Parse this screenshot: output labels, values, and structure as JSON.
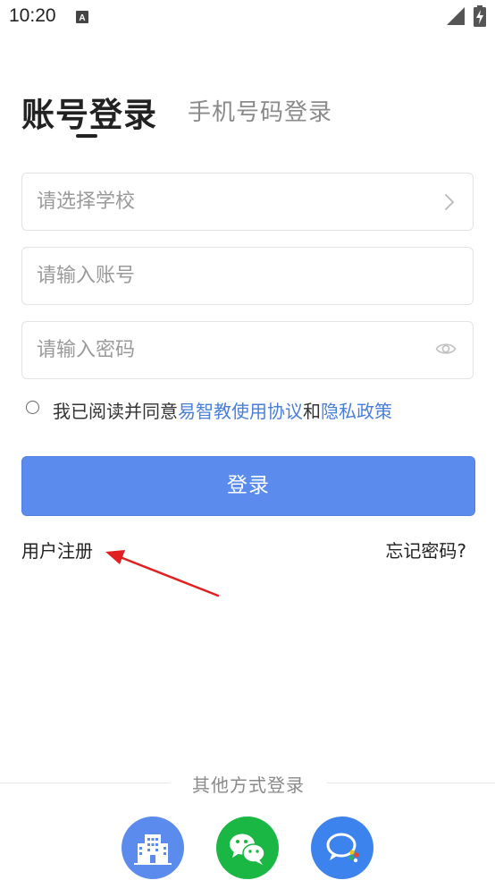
{
  "status_bar": {
    "time": "10:20",
    "notification_icon": "a-box-icon",
    "signal_icon": "signal-icon",
    "battery_icon": "battery-charging-icon"
  },
  "tabs": {
    "account_login": "账号登录",
    "phone_login": "手机号码登录"
  },
  "form": {
    "school_placeholder": "请选择学校",
    "account_placeholder": "请输入账号",
    "password_placeholder": "请输入密码"
  },
  "agreement": {
    "prefix": "我已阅读并同意",
    "terms_link": "易智教使用协议",
    "conjunction": "和",
    "privacy_link": "隐私政策"
  },
  "buttons": {
    "login": "登录",
    "register": "用户注册",
    "forgot": "忘记密码?"
  },
  "other_login": {
    "label": "其他方式登录",
    "options": [
      {
        "icon": "school-building-icon",
        "color": "#5b8ced"
      },
      {
        "icon": "wechat-icon",
        "color": "#1bb744"
      },
      {
        "icon": "chat-bubble-icon",
        "color": "#3d83ee"
      }
    ]
  },
  "colors": {
    "primary": "#5b8ced",
    "link": "#4a7fd8",
    "annotation": "#e02020"
  }
}
